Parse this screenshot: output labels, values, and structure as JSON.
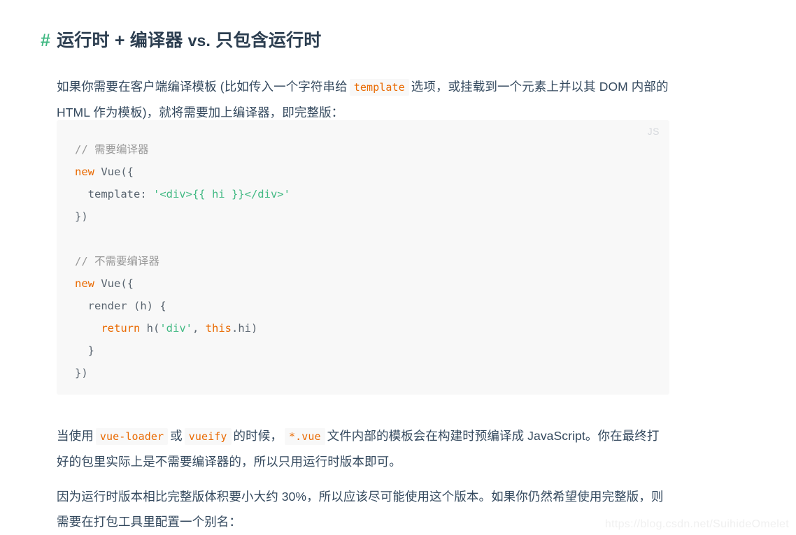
{
  "heading": {
    "anchor": "#",
    "text_before": "运行时 + 编译器 ",
    "vs": "vs.",
    "text_after": " 只包含运行时",
    "full": "# 运行时 + 编译器 vs. 只包含运行时",
    "anchor_color": "#42b983",
    "text_color": "#2c3e50"
  },
  "paragraphs": {
    "p1": {
      "seg1": "如果你需要在客户端编译模板 (比如传入一个字符串给",
      "code1": "template",
      "seg2": "选项，或挂载到一个元素上并以其 DOM 内部的 HTML 作为模板)，就将需要加上编译器，即完整版："
    },
    "p2": {
      "seg1": "当使用",
      "code1": "vue-loader",
      "seg2": "或",
      "code2": "vueify",
      "seg3": "的时候，",
      "code3": "*.vue",
      "seg4": "文件内部的模板会在构建时预编译成 JavaScript。你在最终打好的包里实际上是不需要编译器的，所以只用运行时版本即可。"
    },
    "p3": {
      "text": "因为运行时版本相比完整版体积要小大约 30%，所以应该尽可能使用这个版本。如果你仍然希望使用完整版，则需要在打包工具里配置一个别名："
    }
  },
  "code_block": {
    "language_label": "JS",
    "background": "#f8f8f8",
    "colors": {
      "comment": "#999999",
      "keyword": "#e96900",
      "string": "#42b983",
      "plain": "#5a6570"
    },
    "lines": [
      [
        {
          "t": "// 需要编译器",
          "c": "comment"
        }
      ],
      [
        {
          "t": "new",
          "c": "keyword"
        },
        {
          "t": " Vue({",
          "c": "plain"
        }
      ],
      [
        {
          "t": "  template: ",
          "c": "plain"
        },
        {
          "t": "'<div>{{ hi }}</div>'",
          "c": "string"
        }
      ],
      [
        {
          "t": "})",
          "c": "plain"
        }
      ],
      [
        {
          "t": "",
          "c": "plain"
        }
      ],
      [
        {
          "t": "// 不需要编译器",
          "c": "comment"
        }
      ],
      [
        {
          "t": "new",
          "c": "keyword"
        },
        {
          "t": " Vue({",
          "c": "plain"
        }
      ],
      [
        {
          "t": "  render (h) {",
          "c": "plain"
        }
      ],
      [
        {
          "t": "    ",
          "c": "plain"
        },
        {
          "t": "return",
          "c": "keyword"
        },
        {
          "t": " h(",
          "c": "plain"
        },
        {
          "t": "'div'",
          "c": "string"
        },
        {
          "t": ", ",
          "c": "plain"
        },
        {
          "t": "this",
          "c": "keyword"
        },
        {
          "t": ".hi)",
          "c": "plain"
        }
      ],
      [
        {
          "t": "  }",
          "c": "plain"
        }
      ],
      [
        {
          "t": "})",
          "c": "plain"
        }
      ]
    ]
  },
  "watermark": {
    "text": "https://blog.csdn.net/SuihideOmelet"
  },
  "inline_code_style": {
    "text_color": "#e96900",
    "background": "#f8f8f8"
  }
}
